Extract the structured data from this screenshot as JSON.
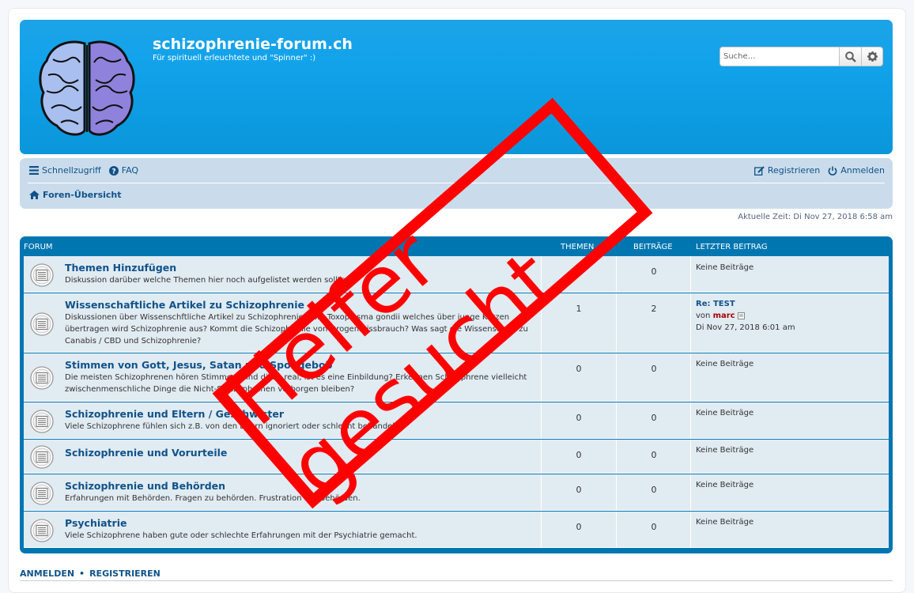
{
  "header": {
    "site_title": "schizophrenie-forum.ch",
    "site_description": "Für spirituell erleuchtete und \"Spinner\" :)",
    "search_placeholder": "Suche…"
  },
  "navbar": {
    "quick_links": "Schnellzugriff",
    "faq": "FAQ",
    "register": "Registrieren",
    "login": "Anmelden",
    "breadcrumb": "Foren-Übersicht"
  },
  "current_time": "Aktuelle Zeit: Di Nov 27, 2018 6:58 am",
  "forum_table": {
    "headers": {
      "forum": "Forum",
      "topics": "Themen",
      "posts": "Beiträge",
      "last_post": "Letzter Beitrag"
    },
    "rows": [
      {
        "title": "Themen Hinzufügen",
        "desc": "Diskussion darüber welche Themen hier noch aufgelistet werden sollten",
        "topics": "0",
        "posts": "0",
        "last": "Keine Beiträge"
      },
      {
        "title": "Wissenschaftliche Artikel zu Schizophrenie",
        "desc": "Diskussionen über Wissenschftliche Artikel zu Schizophrenie. Löst Toxoplasma gondii welches über junge Katzen übertragen wird Schizophrenie aus? Kommt die Schizophrenie von Drogenmissbrauch? Was sagt die Wissenschaft zu Canabis / CBD und Schizophrenie?",
        "topics": "1",
        "posts": "2",
        "last_title": "Re: TEST",
        "last_by": "von",
        "last_author": "marc",
        "last_time": "Di Nov 27, 2018 6:01 am"
      },
      {
        "title": "Stimmen von Gott, Jesus, Satan und Spongebob",
        "desc": "Die meisten Schizophrenen hören Stimmen, sind diese real, ist es eine Einbildung? Erkennen Schizophrene vielleicht zwischenmenschliche Dinge die Nicht-Schizophrenen verborgen bleiben?",
        "topics": "0",
        "posts": "0",
        "last": "Keine Beiträge"
      },
      {
        "title": "Schizophrenie und Eltern / Geschwister",
        "desc": "Viele Schizophrene fühlen sich z.B. von den Eltern ignoriert oder schlecht behandelt.",
        "topics": "0",
        "posts": "0",
        "last": "Keine Beiträge"
      },
      {
        "title": "Schizophrenie und Vorurteile",
        "desc": "",
        "topics": "0",
        "posts": "0",
        "last": "Keine Beiträge"
      },
      {
        "title": "Schizophrenie und Behörden",
        "desc": "Erfahrungen mit Behörden. Fragen zu behörden. Frustration mit Behörden.",
        "topics": "0",
        "posts": "0",
        "last": "Keine Beiträge"
      },
      {
        "title": "Psychiatrie",
        "desc": "Viele Schizophrene haben gute oder schlechte Erfahrungen mit der Psychiatrie gemacht.",
        "topics": "0",
        "posts": "0",
        "last": "Keine Beiträge"
      }
    ]
  },
  "footer": {
    "login": "ANMELDEN",
    "separator": "•",
    "register": "REGISTRIEREN"
  },
  "stamp": {
    "text": "Helfer gesucht",
    "color": "#ff0000"
  },
  "colors": {
    "header_blue": "#12a3eb",
    "link_blue": "#105289",
    "nav_bg": "#cadceb",
    "table_border": "#0076b1"
  }
}
